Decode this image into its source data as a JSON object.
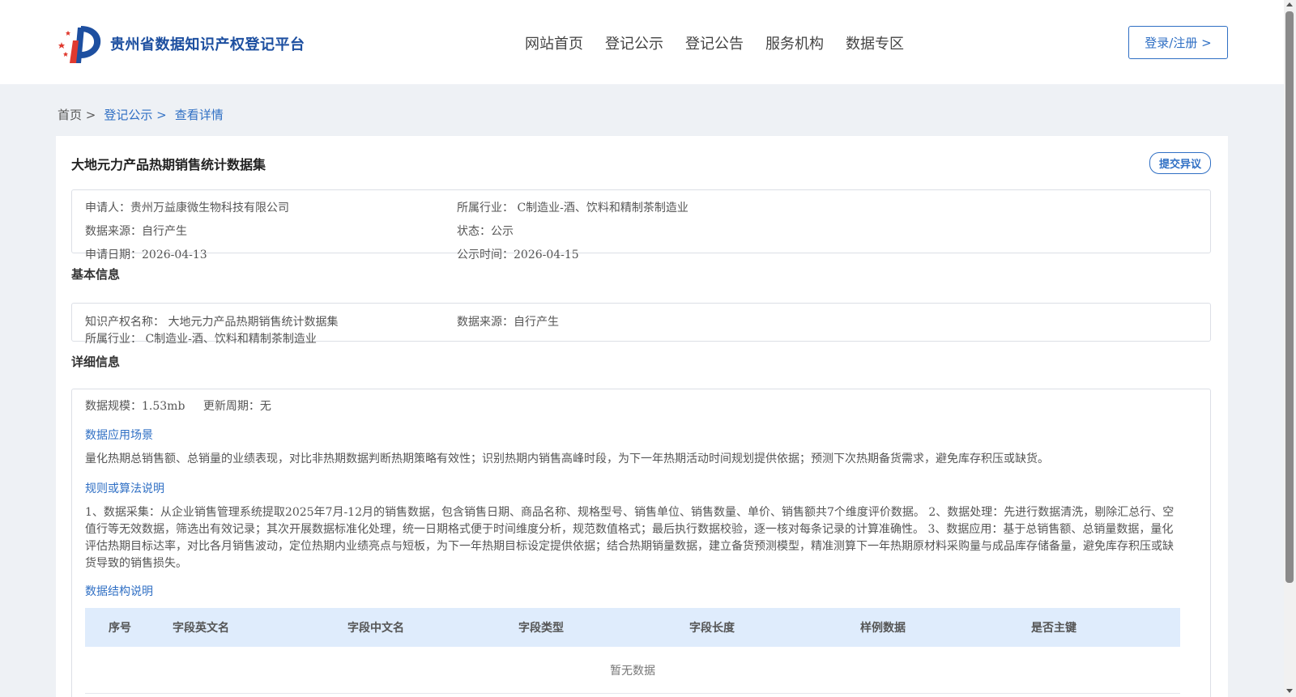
{
  "header": {
    "logo_text": "贵州省数据知识产权登记平台",
    "nav": [
      "网站首页",
      "登记公示",
      "登记公告",
      "服务机构",
      "数据专区"
    ],
    "login_label": "登录/注册 >"
  },
  "breadcrumb": {
    "home": "首页 >",
    "level1": "登记公示 >",
    "level2": "查看详情"
  },
  "detail": {
    "title": "大地元力产品热期销售统计数据集",
    "objection_label": "提交异议",
    "summary": {
      "applicant": "申请人：贵州万益康微生物科技有限公司",
      "industry": "所属行业： C制造业-酒、饮料和精制茶制造业",
      "source": "数据来源：自行产生",
      "status": "状态：公示",
      "apply_date": "申请日期：2026-04-13",
      "publish_date": "公示时间：2026-04-15"
    }
  },
  "basic_info": {
    "section_title": "基本信息",
    "ip_name": "知识产权名称： 大地元力产品热期销售统计数据集",
    "source": "数据来源：自行产生",
    "industry": "所属行业： C制造业-酒、饮料和精制茶制造业"
  },
  "detail_info": {
    "section_title": "详细信息",
    "scale": "数据规模：1.53mb",
    "update_cycle": "更新周期：无",
    "scenario_title": "数据应用场景",
    "scenario_text": "量化热期总销售额、总销量的业绩表现，对比非热期数据判断热期策略有效性；识别热期内销售高峰时段，为下一年热期活动时间规划提供依据；预测下次热期备货需求，避免库存积压或缺货。",
    "algorithm_title": "规则或算法说明",
    "algorithm_text": "1、数据采集：从企业销售管理系统提取2025年7月-12月的销售数据，包含销售日期、商品名称、规格型号、销售单位、销售数量、单价、销售额共7个维度评价数据。 2、数据处理：先进行数据清洗，剔除汇总行、空值行等无效数据，筛选出有效记录；其次开展数据标准化处理，统一日期格式便于时间维度分析，规范数值格式；最后执行数据校验，逐一核对每条记录的计算准确性。 3、数据应用：基于总销售额、总销量数据，量化评估热期目标达率，对比各月销售波动，定位热期内业绩亮点与短板，为下一年热期目标设定提供依据；结合热期销量数据，建立备货预测模型，精准测算下一年热期原材料采购量与成品库存储备量，避免库存积压或缺货导致的销售损失。",
    "structure_title": "数据结构说明",
    "table": {
      "headers": [
        "序号",
        "字段英文名",
        "字段中文名",
        "字段类型",
        "字段长度",
        "样例数据",
        "是否主键"
      ],
      "empty_text": "暂无数据"
    }
  }
}
